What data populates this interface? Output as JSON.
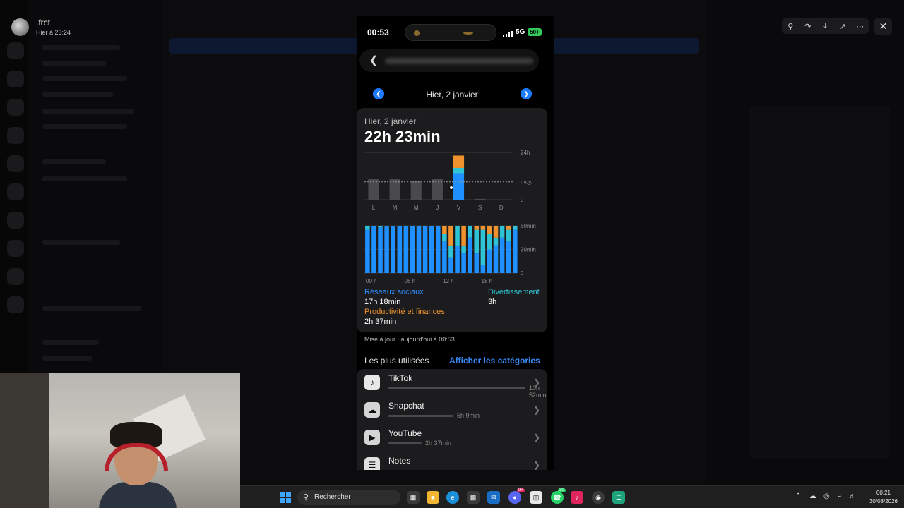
{
  "viewer": {
    "user_name": ".frct",
    "user_time": "Hier à 23:24"
  },
  "phone": {
    "status": {
      "time": "00:53",
      "network": "5G",
      "battery": "50+"
    },
    "day_label": "Hier, 2 janvier",
    "card": {
      "subtitle": "Hier, 2 janvier",
      "total": "22h 23min"
    },
    "weekly_chart": {
      "type": "bar",
      "categories": [
        "L",
        "M",
        "M",
        "J",
        "V",
        "S",
        "D"
      ],
      "values_hours": [
        10.5,
        10.5,
        9.5,
        10.5,
        22.4,
        0.4,
        0
      ],
      "selected_index": 4,
      "average_label": "moy.",
      "ytick_labels": [
        "24h",
        "0"
      ],
      "ylim": [
        0,
        24
      ]
    },
    "hourly_chart": {
      "type": "bar",
      "stacked": true,
      "xtick_labels": [
        "00 h",
        "06 h",
        "12 h",
        "18 h"
      ],
      "ytick_labels": [
        "60min",
        "30min",
        "0"
      ],
      "ylim": [
        0,
        60
      ],
      "series": [
        {
          "name": "Réseaux sociaux",
          "color": "#1e90ff",
          "values": [
            55,
            60,
            58,
            60,
            60,
            60,
            60,
            60,
            60,
            60,
            60,
            60,
            40,
            20,
            35,
            25,
            45,
            25,
            10,
            30,
            35,
            45,
            40,
            55
          ]
        },
        {
          "name": "Divertissement",
          "color": "#2ec4d6",
          "values": [
            5,
            0,
            2,
            0,
            0,
            0,
            0,
            0,
            0,
            0,
            0,
            0,
            10,
            15,
            25,
            10,
            15,
            30,
            45,
            20,
            10,
            15,
            15,
            5
          ]
        },
        {
          "name": "Productivité et finances",
          "color": "#f0922e",
          "values": [
            0,
            0,
            0,
            0,
            0,
            0,
            0,
            0,
            0,
            0,
            0,
            0,
            10,
            25,
            0,
            25,
            0,
            5,
            5,
            10,
            15,
            0,
            5,
            0
          ]
        }
      ]
    },
    "legend": [
      {
        "label": "Réseaux sociaux",
        "value": "17h 18min",
        "color": "#2f8cff"
      },
      {
        "label": "Divertissement",
        "value": "3h",
        "color": "#2ec4d6"
      },
      {
        "label": "Productivité et finances",
        "value": "2h 37min",
        "color": "#f0922e"
      }
    ],
    "updated": "Mise à jour : aujourd'hui à 00:53",
    "most_used_title": "Les plus utilisées",
    "categories_link": "Afficher les catégories",
    "apps": [
      {
        "name": "TikTok",
        "time": "10h 52min",
        "bar_fraction": 0.485,
        "icon": "tiktok-icon"
      },
      {
        "name": "Snapchat",
        "time": "5h 9min",
        "bar_fraction": 0.23,
        "icon": "snapchat-icon"
      },
      {
        "name": "YouTube",
        "time": "2h 37min",
        "bar_fraction": 0.117,
        "icon": "youtube-icon"
      },
      {
        "name": "Notes",
        "time": "",
        "bar_fraction": 0.05,
        "icon": "notes-icon"
      }
    ]
  },
  "taskbar": {
    "search_label": "Rechercher",
    "clock_time": "00:21",
    "clock_date": "30/08/2026"
  }
}
